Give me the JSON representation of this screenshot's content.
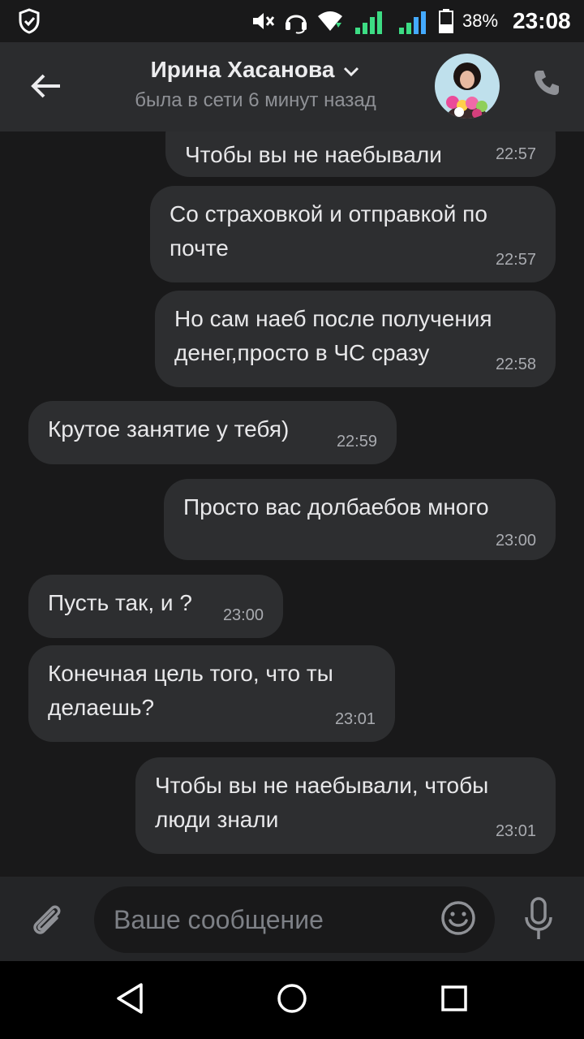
{
  "status_bar": {
    "battery": "38%",
    "time": "23:08",
    "icons": [
      "shield-check-icon",
      "mute-icon",
      "headset-icon",
      "wifi-icon",
      "signal-icon",
      "signal-icon",
      "battery-icon"
    ]
  },
  "header": {
    "contact_name": "Ирина Хасанова",
    "last_seen": "была в сети 6 минут назад",
    "icons": [
      "back-arrow-icon",
      "chevron-down-icon",
      "phone-icon"
    ]
  },
  "messages": [
    {
      "dir": "out",
      "text": "Чтобы вы не наебывали",
      "time": "22:57"
    },
    {
      "dir": "out",
      "text": "Со страховкой и отправкой по почте",
      "time": "22:57"
    },
    {
      "dir": "out",
      "text": "Но сам наеб после получения денег,просто в ЧС сразу",
      "time": "22:58"
    },
    {
      "dir": "in",
      "text": "Крутое занятие у тебя)",
      "time": "22:59"
    },
    {
      "dir": "out",
      "text": "Просто вас долбаебов много",
      "time": "23:00"
    },
    {
      "dir": "in",
      "text": "Пусть так, и ?",
      "time": "23:00"
    },
    {
      "dir": "in",
      "text": "Конечная цель того, что ты делаешь?",
      "time": "23:01"
    },
    {
      "dir": "out",
      "text": "Чтобы вы не наебывали, чтобы люди знали",
      "time": "23:01"
    }
  ],
  "composer": {
    "placeholder": "Ваше сообщение",
    "icons": [
      "paperclip-icon",
      "emoji-icon",
      "microphone-icon"
    ]
  },
  "navigation": {
    "icons": [
      "back-triangle-icon",
      "home-circle-icon",
      "recents-square-icon"
    ]
  },
  "colors": {
    "background": "#19191a",
    "header": "#2b2c2e",
    "bubble": "#2d2e30",
    "text": "#e8e8ea",
    "muted": "#8f9196"
  }
}
